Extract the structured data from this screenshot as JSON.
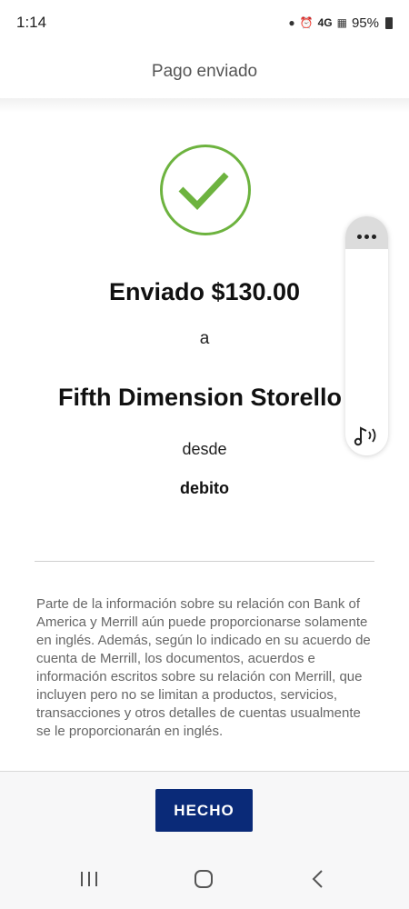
{
  "status_bar": {
    "time": "1:14",
    "network": "4G",
    "battery": "95%"
  },
  "header": {
    "title": "Pago enviado"
  },
  "confirmation": {
    "icon": "check-circle-icon",
    "sent_text": "Enviado $130.00",
    "to_text": "a",
    "recipient": "Fifth Dimension Storello",
    "from_text": "desde",
    "account": "debito"
  },
  "disclaimer": "Parte de la información sobre su relación con Bank of America y Merrill aún puede proporcionarse solamente en inglés. Además, según lo indicado en su acuerdo de cuenta de Merrill, los documentos, acuerdos e información escritos sobre su relación con Merrill, que incluyen pero no se limitan a productos, servicios, transacciones y otros detalles de cuentas usualmente se le proporcionarán en inglés.",
  "footer": {
    "done_label": "HECHO"
  },
  "colors": {
    "accent_green": "#6db33f",
    "button_blue": "#0a2a78"
  },
  "icons": {
    "floating_menu": "more-dots-icon",
    "floating_audio": "audio-music-icon",
    "nav_recent": "recent-apps-icon",
    "nav_home": "home-icon",
    "nav_back": "back-icon"
  }
}
